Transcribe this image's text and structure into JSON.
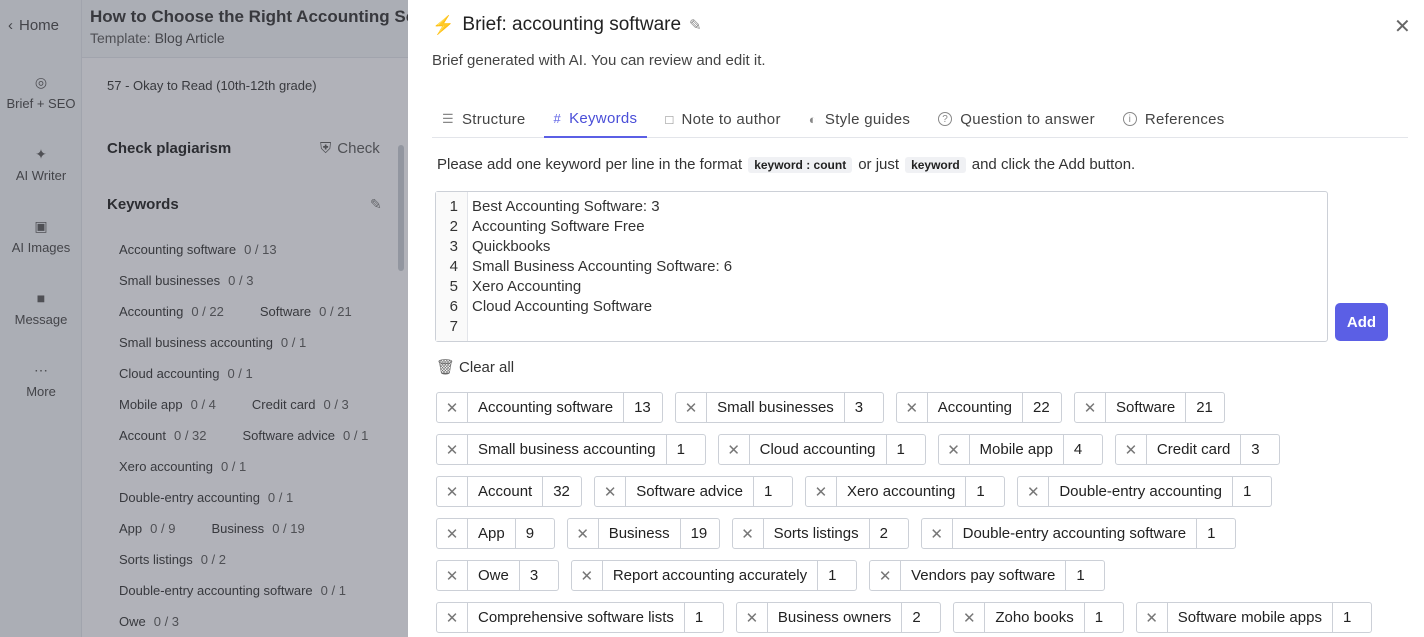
{
  "bg": {
    "home": "Home",
    "doc_title": "How to Choose the Right Accounting Soft",
    "template_label": "Template:",
    "template_value": "Blog Article",
    "nav": [
      {
        "label": "Brief + SEO",
        "icon": "target-icon"
      },
      {
        "label": "AI Writer",
        "icon": "sparkle-icon"
      },
      {
        "label": "AI Images",
        "icon": "image-icon"
      },
      {
        "label": "Message",
        "icon": "message-icon"
      },
      {
        "label": "More",
        "icon": "more-icon"
      }
    ],
    "readability": "57 - Okay to Read (10th-12th grade)",
    "plagiarism": "Check plagiarism",
    "check": "Check",
    "keywords_header": "Keywords",
    "keyword_lines": [
      [
        {
          "name": "Accounting software",
          "count": "0 / 13"
        }
      ],
      [
        {
          "name": "Small businesses",
          "count": "0 / 3"
        }
      ],
      [
        {
          "name": "Accounting",
          "count": "0 / 22"
        },
        {
          "name": "Software",
          "count": "0 / 21"
        }
      ],
      [
        {
          "name": "Small business accounting",
          "count": "0 / 1"
        }
      ],
      [
        {
          "name": "Cloud accounting",
          "count": "0 / 1"
        }
      ],
      [
        {
          "name": "Mobile app",
          "count": "0 / 4"
        },
        {
          "name": "Credit card",
          "count": "0 / 3"
        }
      ],
      [
        {
          "name": "Account",
          "count": "0 / 32"
        },
        {
          "name": "Software advice",
          "count": "0 / 1"
        }
      ],
      [
        {
          "name": "Xero accounting",
          "count": "0 / 1"
        }
      ],
      [
        {
          "name": "Double-entry accounting",
          "count": "0 / 1"
        }
      ],
      [
        {
          "name": "App",
          "count": "0 / 9"
        },
        {
          "name": "Business",
          "count": "0 / 19"
        }
      ],
      [
        {
          "name": "Sorts listings",
          "count": "0 / 2"
        }
      ],
      [
        {
          "name": "Double-entry accounting software",
          "count": "0 / 1"
        }
      ],
      [
        {
          "name": "Owe",
          "count": "0 / 3"
        }
      ]
    ]
  },
  "modal": {
    "title": "Brief: accounting software",
    "subtitle": "Brief generated with AI. You can review and edit it.",
    "tabs": [
      {
        "label": "Structure",
        "icon": "list-icon",
        "active": false
      },
      {
        "label": "Keywords",
        "icon": "hash-icon",
        "active": true
      },
      {
        "label": "Note to author",
        "icon": "note-icon",
        "active": false
      },
      {
        "label": "Style guides",
        "icon": "palette-icon",
        "active": false
      },
      {
        "label": "Question to answer",
        "icon": "question-icon",
        "active": false
      },
      {
        "label": "References",
        "icon": "info-icon",
        "active": false
      }
    ],
    "hint_prefix": "Please add one keyword per line in the format",
    "hint_code1": "keyword : count",
    "hint_mid": "or just",
    "hint_code2": "keyword",
    "hint_suffix": "and click the Add button.",
    "editor_lines": [
      "Best Accounting Software: 3",
      "Accounting Software Free",
      "Quickbooks",
      "Small Business Accounting Software: 6",
      "Xero Accounting",
      "Cloud Accounting Software",
      ""
    ],
    "add_label": "Add",
    "clear_label": "Clear all",
    "chip_rows": [
      [
        {
          "name": "Accounting software",
          "count": "13"
        },
        {
          "name": "Small businesses",
          "count": "3"
        },
        {
          "name": "Accounting",
          "count": "22"
        },
        {
          "name": "Software",
          "count": "21"
        }
      ],
      [
        {
          "name": "Small business accounting",
          "count": "1"
        },
        {
          "name": "Cloud accounting",
          "count": "1"
        },
        {
          "name": "Mobile app",
          "count": "4"
        },
        {
          "name": "Credit card",
          "count": "3"
        }
      ],
      [
        {
          "name": "Account",
          "count": "32"
        },
        {
          "name": "Software advice",
          "count": "1"
        },
        {
          "name": "Xero accounting",
          "count": "1"
        },
        {
          "name": "Double-entry accounting",
          "count": "1"
        }
      ],
      [
        {
          "name": "App",
          "count": "9"
        },
        {
          "name": "Business",
          "count": "19"
        },
        {
          "name": "Sorts listings",
          "count": "2"
        },
        {
          "name": "Double-entry accounting software",
          "count": "1"
        }
      ],
      [
        {
          "name": "Owe",
          "count": "3"
        },
        {
          "name": "Report accounting accurately",
          "count": "1"
        },
        {
          "name": "Vendors pay software",
          "count": "1"
        }
      ],
      [
        {
          "name": "Comprehensive software lists",
          "count": "1"
        },
        {
          "name": "Business owners",
          "count": "2"
        },
        {
          "name": "Zoho books",
          "count": "1"
        },
        {
          "name": "Software mobile apps",
          "count": "1"
        }
      ]
    ]
  },
  "colors": {
    "accent": "#5b5fe5",
    "overlay": "rgba(30,35,50,0.32)"
  }
}
